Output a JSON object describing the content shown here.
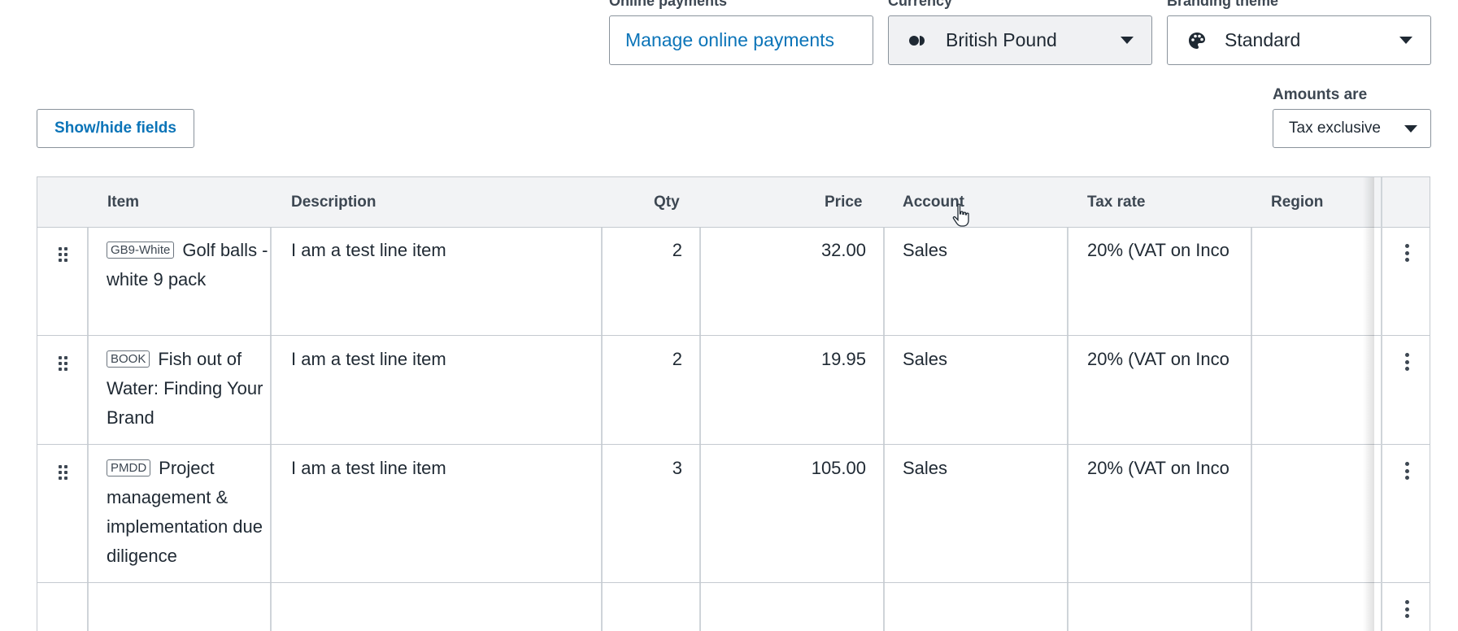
{
  "top_fields": {
    "online_payments": {
      "label": "Online payments",
      "link": "Manage online payments"
    },
    "currency": {
      "label": "Currency",
      "value": "British Pound",
      "icon": "currency-icon"
    },
    "branding": {
      "label": "Branding theme",
      "value": "Standard",
      "icon": "palette-icon"
    }
  },
  "toolbar": {
    "show_hide_label": "Show/hide fields"
  },
  "amounts": {
    "label": "Amounts are",
    "value": "Tax exclusive"
  },
  "table": {
    "headers": [
      "Item",
      "Description",
      "Qty",
      "Price",
      "Account",
      "Tax rate",
      "Region"
    ],
    "rows": [
      {
        "code": "GB9-White",
        "item": "Golf balls - white 9 pack",
        "description": "I am a test line item",
        "qty": "2",
        "price": "32.00",
        "account": "Sales",
        "tax_rate": "20% (VAT on Inco",
        "region": ""
      },
      {
        "code": "BOOK",
        "item": "Fish out of Water: Finding Your Brand",
        "description": "I am a test line item",
        "qty": "2",
        "price": "19.95",
        "account": "Sales",
        "tax_rate": "20% (VAT on Inco",
        "region": ""
      },
      {
        "code": "PMDD",
        "item": "Project management & implementation due diligence",
        "description": "I am a test line item",
        "qty": "3",
        "price": "105.00",
        "account": "Sales",
        "tax_rate": "20% (VAT on Inco",
        "region": ""
      }
    ]
  }
}
